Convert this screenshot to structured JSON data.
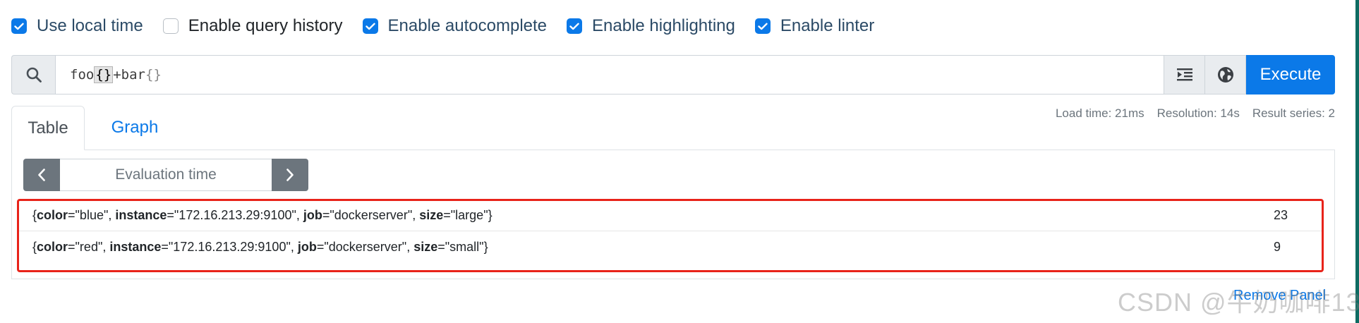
{
  "options": [
    {
      "label": "Use local time",
      "checked": true
    },
    {
      "label": "Enable query history",
      "checked": false
    },
    {
      "label": "Enable autocomplete",
      "checked": true
    },
    {
      "label": "Enable highlighting",
      "checked": true
    },
    {
      "label": "Enable linter",
      "checked": true
    }
  ],
  "query": {
    "tokens": {
      "t1": "foo",
      "t2": "{}",
      "t3": "+ ",
      "t4": "bar",
      "t5": "{}"
    },
    "execute_label": "Execute"
  },
  "tabs": [
    {
      "label": "Table",
      "active": true
    },
    {
      "label": "Graph",
      "active": false
    }
  ],
  "stats": {
    "load_time": "Load time: 21ms",
    "resolution": "Resolution: 14s",
    "result_series": "Result series: 2"
  },
  "eval": {
    "placeholder": "Evaluation time"
  },
  "results": [
    {
      "labels": [
        {
          "name": "color",
          "value": "\"blue\""
        },
        {
          "name": "instance",
          "value": "\"172.16.213.29:9100\""
        },
        {
          "name": "job",
          "value": "\"dockerserver\""
        },
        {
          "name": "size",
          "value": "\"large\""
        }
      ],
      "value": "23"
    },
    {
      "labels": [
        {
          "name": "color",
          "value": "\"red\""
        },
        {
          "name": "instance",
          "value": "\"172.16.213.29:9100\""
        },
        {
          "name": "job",
          "value": "\"dockerserver\""
        },
        {
          "name": "size",
          "value": "\"small\""
        }
      ],
      "value": "9"
    }
  ],
  "remove_label": "Remove Panel",
  "watermark": "CSDN @牛奶咖啡13",
  "colors": {
    "accent": "#0b79e8",
    "highlight": "#e8231a",
    "nav": "#6c757d"
  }
}
